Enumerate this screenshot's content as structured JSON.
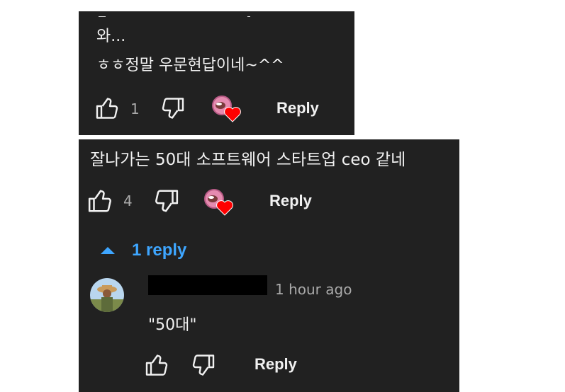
{
  "comment_top": {
    "lines": [
      "와...",
      "ㅎㅎ정말 우문현답이네~^^"
    ],
    "like_count": "1",
    "reply_label": "Reply",
    "heart_icon": "creator-heart-icon"
  },
  "comment_main": {
    "text": "잘나가는 50대 소프트웨어 스타트업 ceo 같네",
    "like_count": "4",
    "reply_label": "Reply",
    "heart_icon": "creator-heart-icon"
  },
  "replies_toggle": {
    "label": "1 reply",
    "icon": "caret-up-icon",
    "color": "#3ea6ff"
  },
  "reply_comment": {
    "author_redacted": true,
    "timestamp": "1 hour ago",
    "text": "\"50대\"",
    "reply_label": "Reply"
  },
  "colors": {
    "panel_bg": "#212121",
    "text": "#f1f1f1",
    "muted": "#aaaaaa",
    "accent": "#3ea6ff",
    "heart": "#ff0000"
  }
}
